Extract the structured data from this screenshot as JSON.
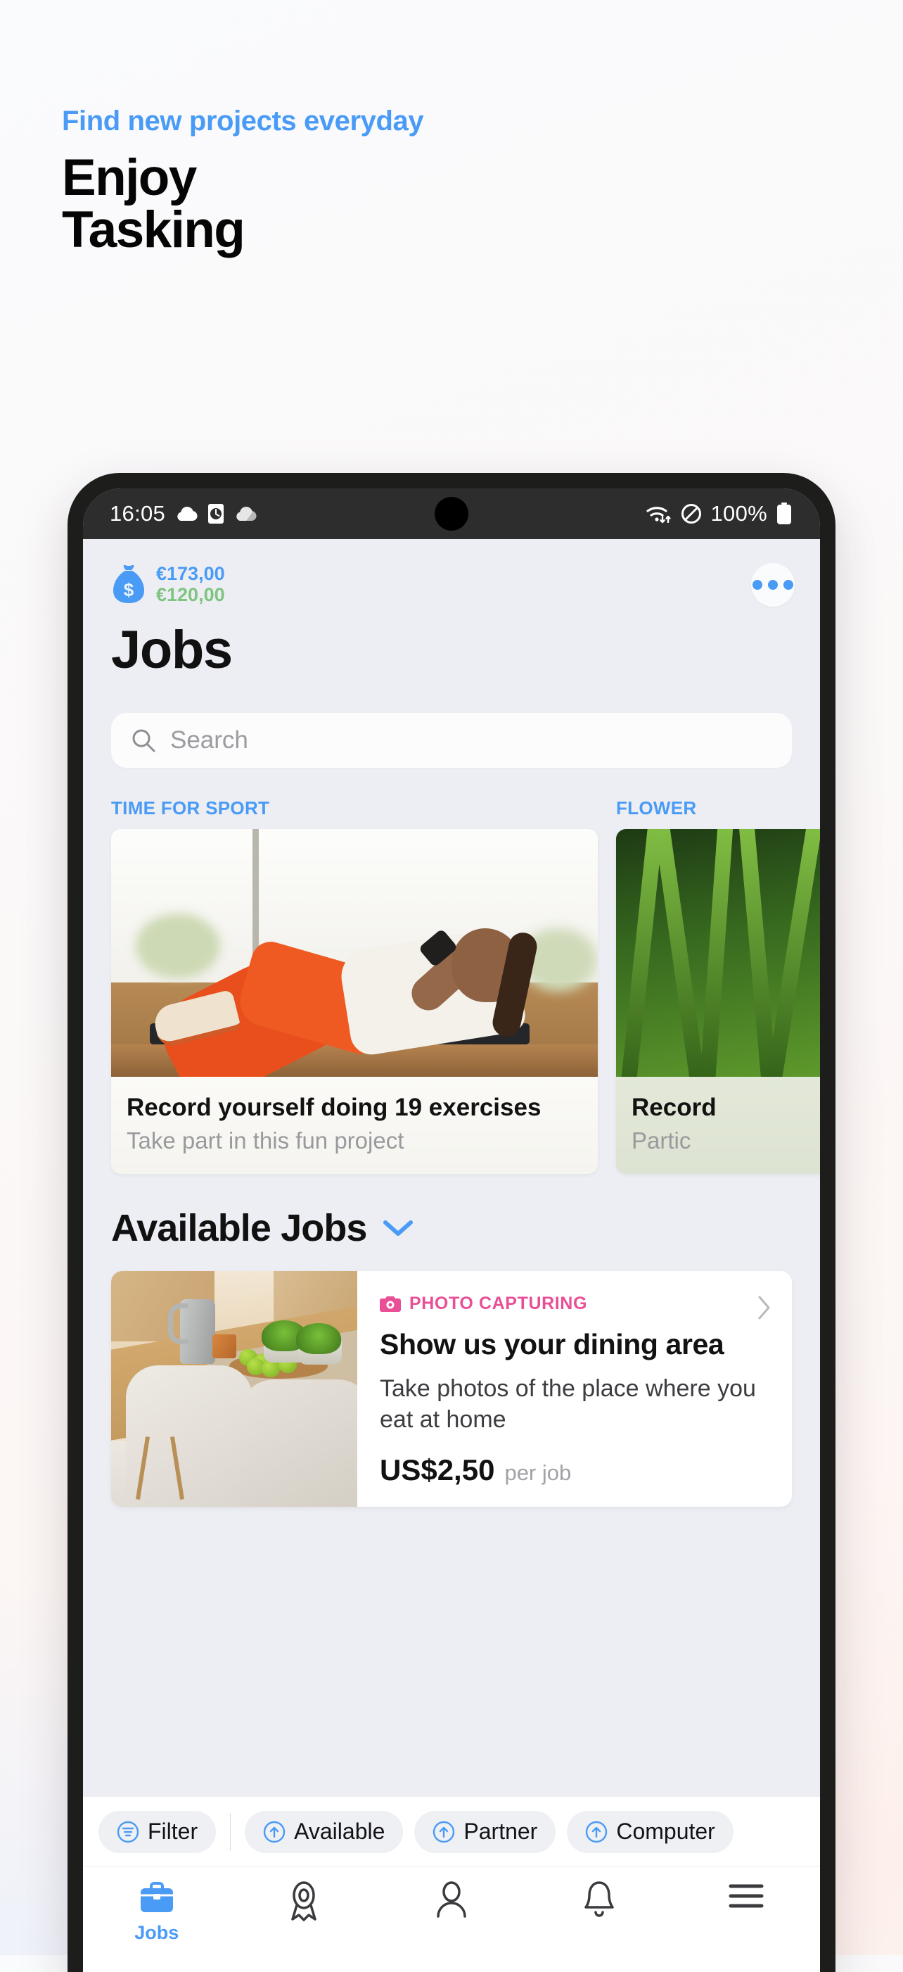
{
  "promo": {
    "eyebrow": "Find new projects everyday",
    "title_line1": "Enjoy",
    "title_line2": "Tasking"
  },
  "statusbar": {
    "time": "16:05",
    "battery_percent": "100%",
    "icons_left": [
      "cloud-icon",
      "clock-box-icon",
      "cloud-sync-icon"
    ],
    "icons_right": [
      "wifi-transfer-icon",
      "do-not-disturb-icon",
      "battery-full-icon"
    ]
  },
  "app": {
    "money": {
      "icon": "money-bag-icon",
      "primary_amount": "€173,00",
      "secondary_amount": "€120,00",
      "primary_color": "#4a9bf5",
      "secondary_color": "#7fc47f"
    },
    "overflow_menu": "more-options-icon",
    "page_title": "Jobs",
    "search": {
      "placeholder": "Search",
      "icon": "search-icon"
    },
    "carousel": [
      {
        "label": "TIME FOR SPORT",
        "title": "Record yourself doing 19 exercises",
        "subtitle": "Take part in this fun project",
        "image": "woman-doing-situps-photo"
      },
      {
        "label": "FLOWER",
        "title": "Record",
        "subtitle": "Partic",
        "image": "green-grass-photo"
      }
    ],
    "available_jobs": {
      "heading": "Available Jobs",
      "chevron": "chevron-down-icon",
      "jobs": [
        {
          "category": "PHOTO CAPTURING",
          "category_icon": "camera-icon",
          "category_color": "#e94f96",
          "title": "Show us your dining area",
          "description": "Take photos of the place where you eat at home",
          "price": "US$2,50",
          "price_unit": "per job",
          "image": "dining-table-photo",
          "chevron": "chevron-right-icon"
        }
      ]
    },
    "filters": [
      {
        "label": "Filter",
        "icon": "filter-lines-icon"
      },
      {
        "label": "Available",
        "icon": "arrow-up-circle-icon"
      },
      {
        "label": "Partner",
        "icon": "arrow-up-circle-icon"
      },
      {
        "label": "Computer",
        "icon": "arrow-up-circle-icon"
      }
    ],
    "bottom_nav": [
      {
        "label": "Jobs",
        "icon": "briefcase-icon",
        "active": true
      },
      {
        "label": "",
        "icon": "award-ribbon-icon",
        "active": false
      },
      {
        "label": "",
        "icon": "person-icon",
        "active": false
      },
      {
        "label": "",
        "icon": "bell-icon",
        "active": false
      },
      {
        "label": "",
        "icon": "menu-hamburger-icon",
        "active": false
      }
    ]
  }
}
